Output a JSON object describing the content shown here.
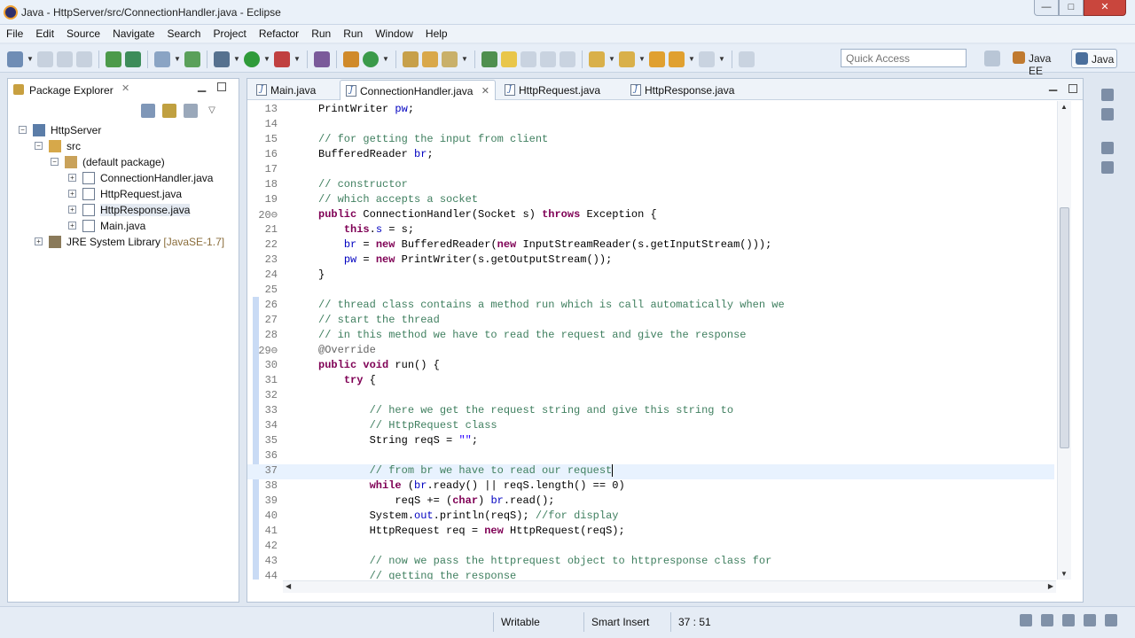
{
  "window": {
    "title": "Java - HttpServer/src/ConnectionHandler.java - Eclipse",
    "min_glyph": "—",
    "max_glyph": "□",
    "close_glyph": "✕"
  },
  "menu": [
    "File",
    "Edit",
    "Source",
    "Navigate",
    "Search",
    "Project",
    "Refactor",
    "Run",
    "Run",
    "Window",
    "Help"
  ],
  "toolbar": {
    "quick_access_placeholder": "Quick Access",
    "perspectives": [
      "Java EE",
      "Java"
    ]
  },
  "package_explorer": {
    "title": "Package Explorer",
    "tree": [
      {
        "label": "HttpServer",
        "decoration": "",
        "icon": "project-icon"
      },
      {
        "label": "src",
        "decoration": "",
        "icon": "source-folder-icon"
      },
      {
        "label": "(default package)",
        "decoration": "",
        "icon": "package-icon"
      },
      {
        "label": "ConnectionHandler.java",
        "decoration": "",
        "icon": "java-file-icon"
      },
      {
        "label": "HttpRequest.java",
        "decoration": "",
        "icon": "java-file-icon"
      },
      {
        "label": "HttpResponse.java",
        "decoration": "",
        "icon": "java-file-icon"
      },
      {
        "label": "Main.java",
        "decoration": "",
        "icon": "java-file-icon"
      },
      {
        "label": "JRE System Library",
        "decoration": "[JavaSE-1.7]",
        "icon": "library-icon"
      }
    ]
  },
  "editor": {
    "tabs": [
      "Main.java",
      "ConnectionHandler.java",
      "HttpRequest.java",
      "HttpResponse.java"
    ],
    "active_tab": "ConnectionHandler.java",
    "lines": [
      {
        "n": "13",
        "code": "PrintWriter pw;"
      },
      {
        "n": "14",
        "code": ""
      },
      {
        "n": "15",
        "code": "// for getting the input from client"
      },
      {
        "n": "16",
        "code": "BufferedReader br;"
      },
      {
        "n": "17",
        "code": ""
      },
      {
        "n": "18",
        "code": "// constructor"
      },
      {
        "n": "19",
        "code": "// which accepts a socket"
      },
      {
        "n": "20⊖",
        "code": "public ConnectionHandler(Socket s) throws Exception {"
      },
      {
        "n": "21",
        "code": "    this.s = s;"
      },
      {
        "n": "22",
        "code": "    br = new BufferedReader(new InputStreamReader(s.getInputStream()));"
      },
      {
        "n": "23",
        "code": "    pw = new PrintWriter(s.getOutputStream());"
      },
      {
        "n": "24",
        "code": "}"
      },
      {
        "n": "25",
        "code": ""
      },
      {
        "n": "26",
        "code": "// thread class contains a method run which is call automatically when we"
      },
      {
        "n": "27",
        "code": "// start the thread"
      },
      {
        "n": "28",
        "code": "// in this method we have to read the request and give the response"
      },
      {
        "n": "29⊖",
        "code": "@Override"
      },
      {
        "n": "30",
        "code": "public void run() {"
      },
      {
        "n": "31",
        "code": "    try {"
      },
      {
        "n": "32",
        "code": ""
      },
      {
        "n": "33",
        "code": "        // here we get the request string and give this string to"
      },
      {
        "n": "34",
        "code": "        // HttpRequest class"
      },
      {
        "n": "35",
        "code": "        String reqS = \"\";"
      },
      {
        "n": "36",
        "code": ""
      },
      {
        "n": "37",
        "code": "        // from br we have to read our request"
      },
      {
        "n": "38",
        "code": "        while (br.ready() || reqS.length() == 0)"
      },
      {
        "n": "39",
        "code": "            reqS += (char) br.read();"
      },
      {
        "n": "40",
        "code": "        System.out.println(reqS); //for display"
      },
      {
        "n": "41",
        "code": "        HttpRequest req = new HttpRequest(reqS);"
      },
      {
        "n": "42",
        "code": ""
      },
      {
        "n": "43",
        "code": "        // now we pass the httprequest object to httpresponse class for"
      },
      {
        "n": "44",
        "code": "        // getting the response"
      }
    ]
  },
  "status": {
    "writable": "Writable",
    "insert_mode": "Smart Insert",
    "position": "37 : 51"
  }
}
